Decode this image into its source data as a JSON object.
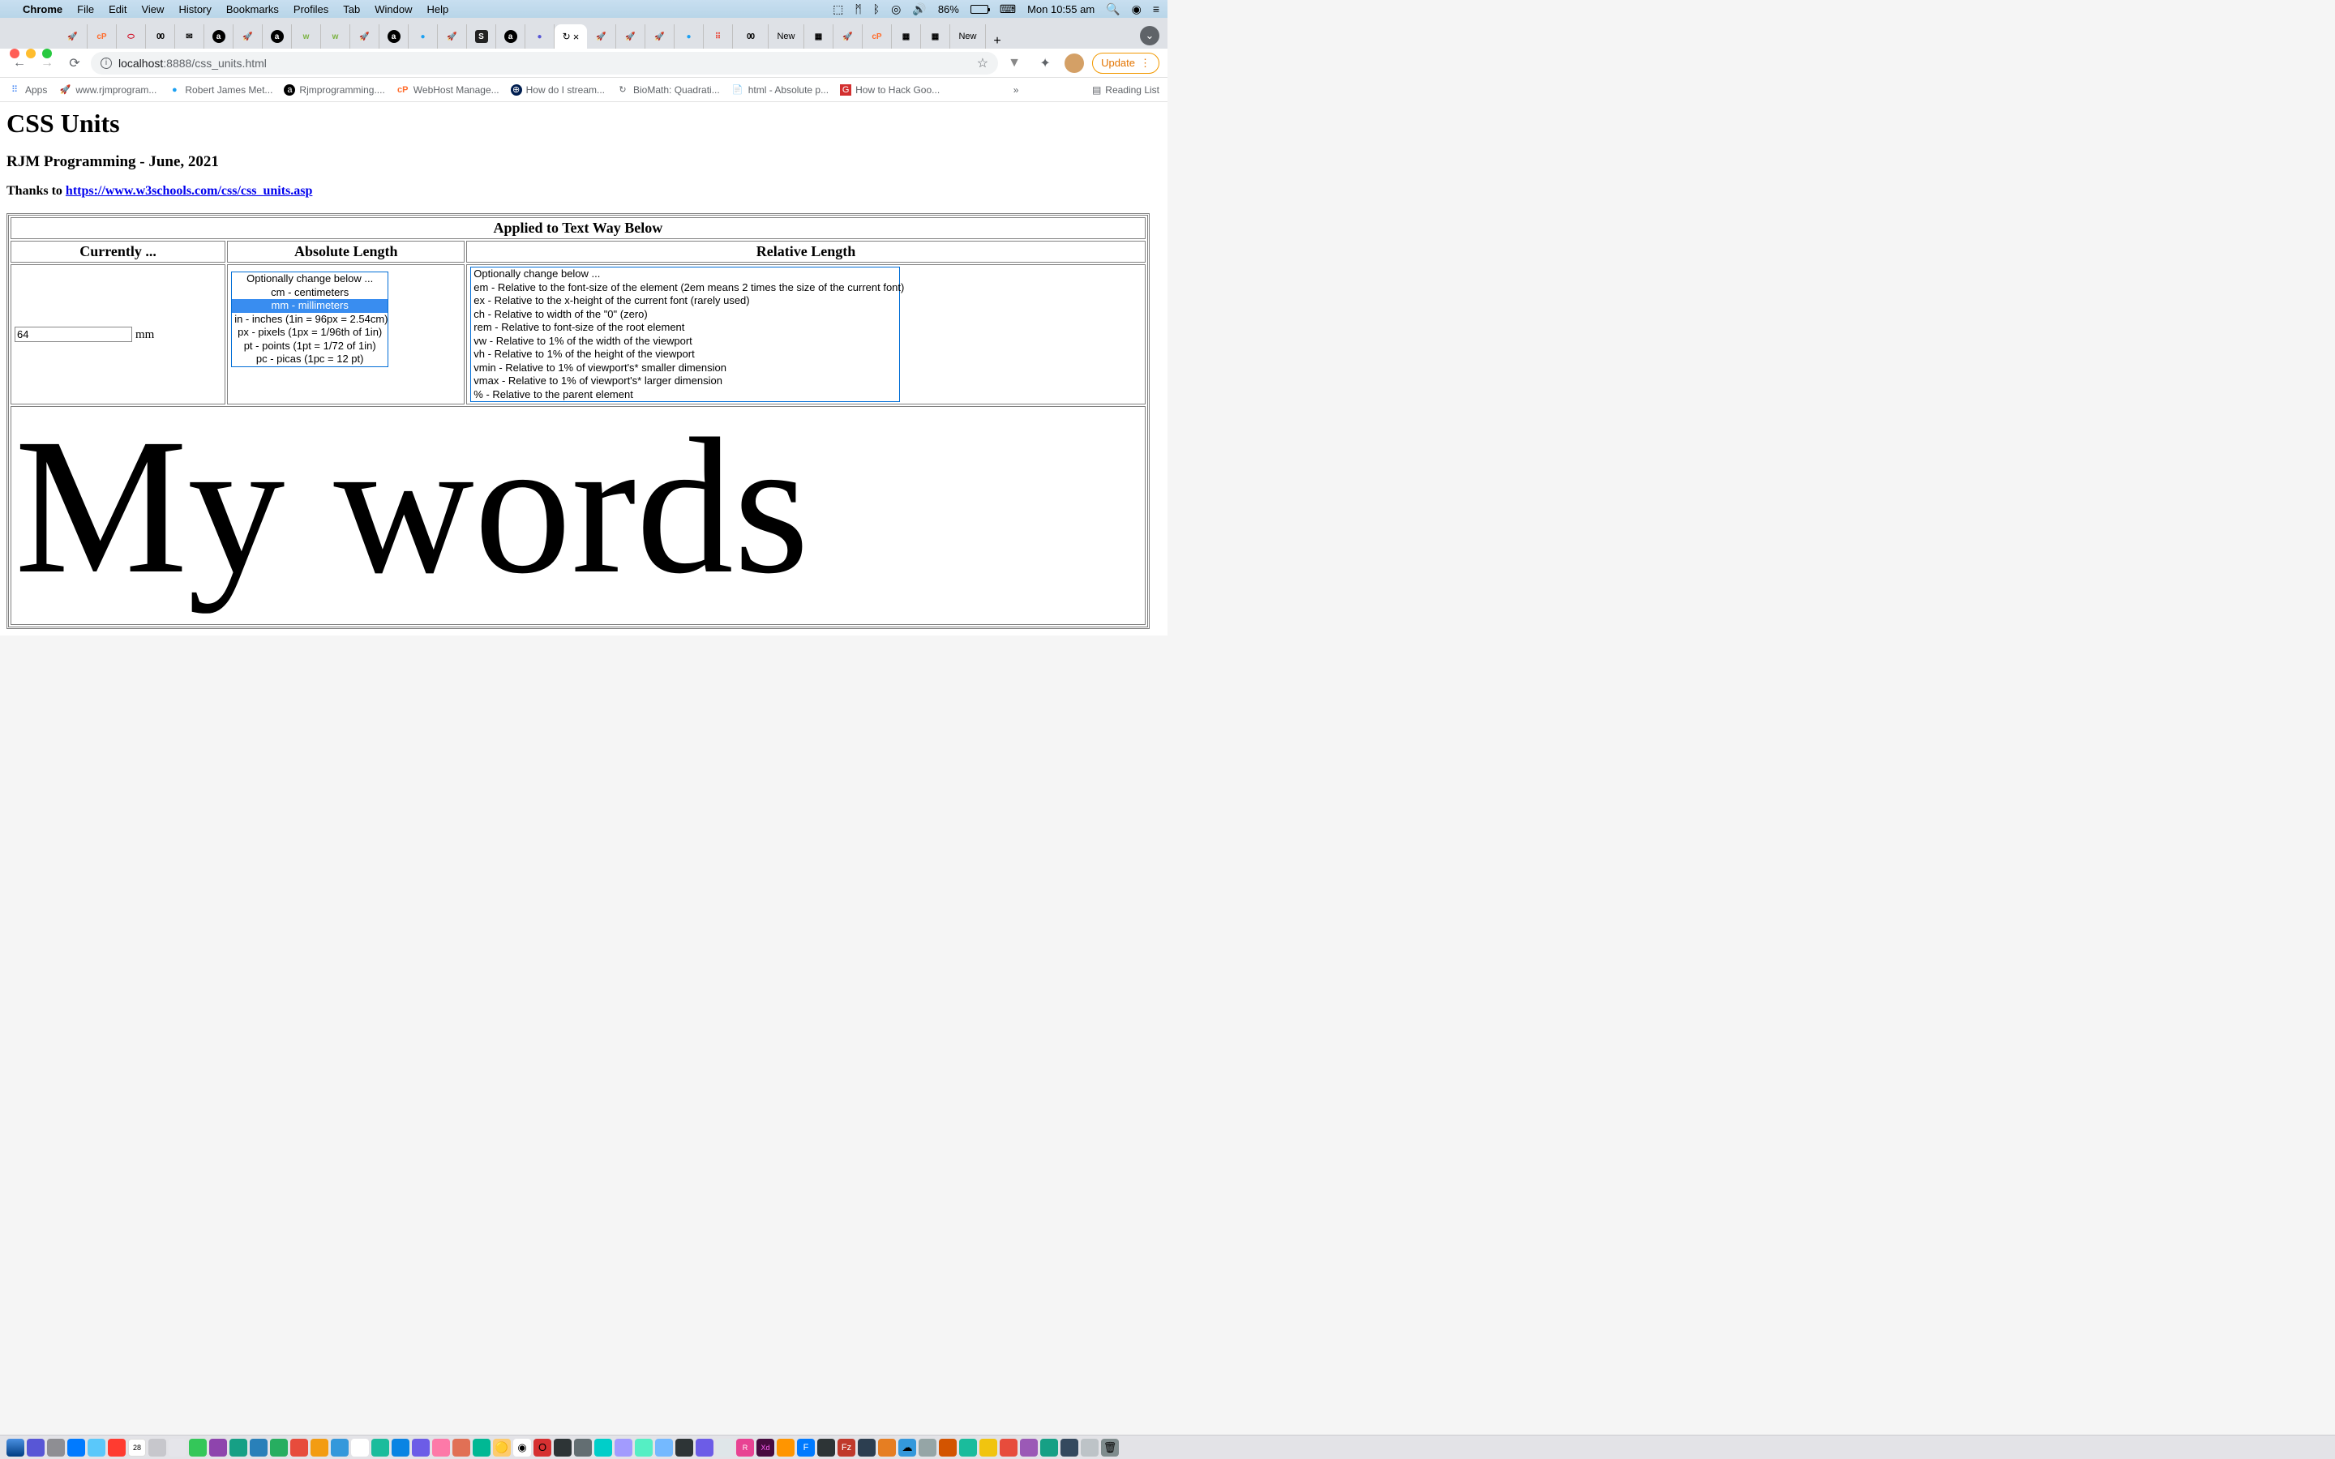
{
  "menubar": {
    "app": "Chrome",
    "items": [
      "File",
      "Edit",
      "View",
      "History",
      "Bookmarks",
      "Profiles",
      "Tab",
      "Window",
      "Help"
    ],
    "battery_pct": "86%",
    "clock": "Mon 10:55 am"
  },
  "tabs": {
    "active_close": "×",
    "new_tab_labels": [
      "New",
      "New"
    ]
  },
  "url": {
    "host": "localhost",
    "port": ":8888",
    "path": "/css_units.html"
  },
  "toolbar": {
    "update": "Update"
  },
  "bookmarks": {
    "apps": "Apps",
    "items": [
      "www.rjmprogram...",
      "Robert James Met...",
      "Rjmprogramming....",
      "WebHost Manage...",
      "How do I stream...",
      "BioMath: Quadrati...",
      "html - Absolute p...",
      "How to Hack Goo..."
    ],
    "more": "»",
    "reading_list": "Reading List"
  },
  "page": {
    "h1": "CSS Units",
    "h2": "RJM Programming - June, 2021",
    "thanks_prefix": "Thanks to ",
    "thanks_link": "https://www.w3schools.com/css/css_units.asp",
    "applied_header": "Applied to Text Way Below",
    "currently_header": "Currently ...",
    "absolute_header": "Absolute Length",
    "relative_header": "Relative Length",
    "current_value": "64",
    "current_unit": "mm",
    "absolute_options": [
      "Optionally change below ...",
      "cm - centimeters",
      "mm - millimeters",
      "in - inches (1in = 96px = 2.54cm)",
      "px - pixels (1px = 1/96th of 1in)",
      "pt - points (1pt = 1/72 of 1in)",
      "pc - picas (1pc = 12 pt)"
    ],
    "absolute_selected_index": 2,
    "relative_options": [
      "Optionally change below ...",
      "em - Relative to the font-size of the element (2em means 2 times the size of the current font)",
      "ex - Relative to the x-height of the current font (rarely used)",
      "ch - Relative to width of the \"0\" (zero)",
      "rem - Relative to font-size of the root element",
      "vw - Relative to 1% of the width of the viewport",
      "vh - Relative to 1% of the height of the viewport",
      "vmin - Relative to 1% of viewport's* smaller dimension",
      "vmax - Relative to 1% of viewport's* larger dimension",
      "% - Relative to the parent element"
    ],
    "big_text": "My words"
  },
  "icons": {
    "cp": "cP",
    "a": "a",
    "abc": "00",
    "gmail": "M",
    "w": "w",
    "s": "S",
    "rocket": "🚀",
    "globe": "●",
    "squares": "⠿",
    "vw": "⊕",
    "biomath": "↻",
    "hack": "G"
  }
}
